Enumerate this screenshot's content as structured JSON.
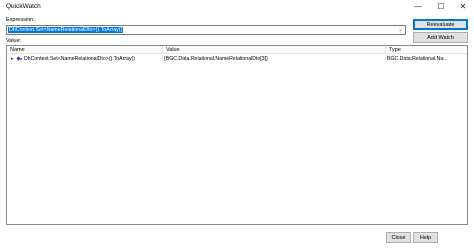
{
  "window": {
    "title": "QuickWatch",
    "minimize_glyph": "—",
    "maximize_glyph": "☐",
    "close_glyph": "✕"
  },
  "expression": {
    "label": "Expression:",
    "value": "DbContext.Set<NameRelationalDto>().ToArray()",
    "dropdown_glyph": "⌄"
  },
  "buttons": {
    "reevaluate": "Reevaluate",
    "add_watch": "Add Watch",
    "close": "Close",
    "help": "Help"
  },
  "value_section": {
    "label": "Value:",
    "columns": [
      "Name",
      "Value",
      "Type"
    ],
    "rows": [
      {
        "expander": "▸",
        "icon": "object-icon",
        "name": "DbContext.Set<NameRelationalDto>().ToArray()",
        "value": "{BGC.Data.Relational.NameRelationalDto[3]}",
        "type": "BGC.Data.Relational.Na..."
      }
    ]
  },
  "colors": {
    "selection": "#0078d7",
    "button_face": "#e1e1e1",
    "border": "#828790"
  }
}
